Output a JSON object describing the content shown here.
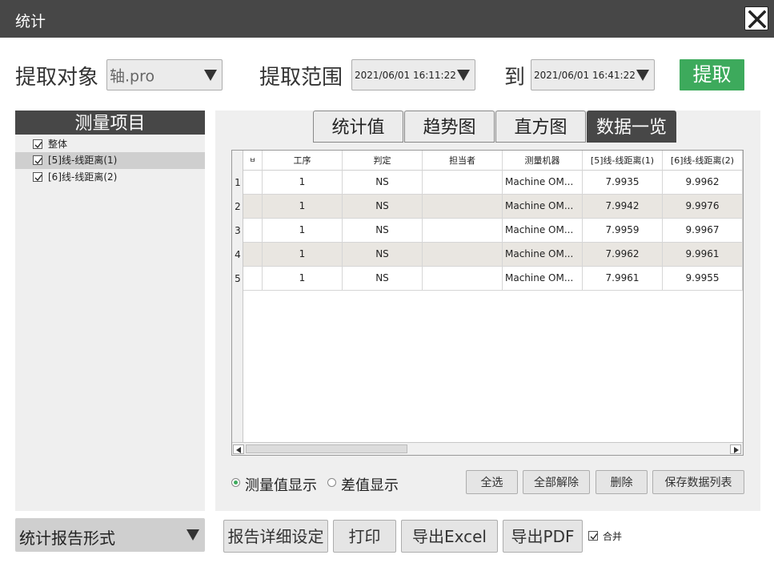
{
  "window": {
    "title": "统计"
  },
  "extract": {
    "target_label": "提取对象",
    "target_value": "轴.pro",
    "range_label": "提取范围",
    "range_from": "2021/06/01 16:11:22",
    "to_label": "到",
    "range_to": "2021/06/01 16:41:22",
    "extract_button": "提取"
  },
  "measure_items": {
    "header": "测量项目",
    "items": [
      {
        "label": "整体",
        "checked": true,
        "selected": false
      },
      {
        "label": "[5]线-线距离(1)",
        "checked": true,
        "selected": true
      },
      {
        "label": "[6]线-线距离(2)",
        "checked": true,
        "selected": false
      }
    ]
  },
  "tabs": [
    {
      "label": "统计值",
      "active": false
    },
    {
      "label": "趋势图",
      "active": false
    },
    {
      "label": "直方图",
      "active": false
    },
    {
      "label": "数据一览",
      "active": true
    }
  ],
  "table": {
    "columns": [
      "",
      "工序",
      "判定",
      "担当者",
      "测量机器",
      "[5]线-线距离(1)",
      "[6]线-线距离(2)"
    ],
    "first_column_header_glyph": "ㅂ",
    "rows": [
      {
        "no": "1",
        "cells": [
          "",
          "1",
          "NS",
          "",
          "Machine OM...",
          "7.9935",
          "9.9962"
        ]
      },
      {
        "no": "2",
        "cells": [
          "",
          "1",
          "NS",
          "",
          "Machine OM...",
          "7.9942",
          "9.9976"
        ]
      },
      {
        "no": "3",
        "cells": [
          "",
          "1",
          "NS",
          "",
          "Machine OM...",
          "7.9959",
          "9.9967"
        ]
      },
      {
        "no": "4",
        "cells": [
          "",
          "1",
          "NS",
          "",
          "Machine OM...",
          "7.9962",
          "9.9961"
        ]
      },
      {
        "no": "5",
        "cells": [
          "",
          "1",
          "NS",
          "",
          "Machine OM...",
          "7.9961",
          "9.9955"
        ]
      }
    ]
  },
  "display_mode": {
    "measured_label": "测量值显示",
    "diff_label": "差值显示",
    "selected": "measured"
  },
  "table_buttons": {
    "select_all": "全选",
    "deselect_all": "全部解除",
    "delete": "删除",
    "save_list": "保存数据列表"
  },
  "report": {
    "format_label": "统计报告形式",
    "detail_settings": "报告详细设定",
    "print": "打印",
    "export_excel": "导出Excel",
    "export_pdf": "导出PDF",
    "merge_label": "合并",
    "merge_checked": true
  },
  "colors": {
    "titlebar": "#474747",
    "accent_green": "#3daa5c",
    "alt_row": "#e9e6e1"
  }
}
